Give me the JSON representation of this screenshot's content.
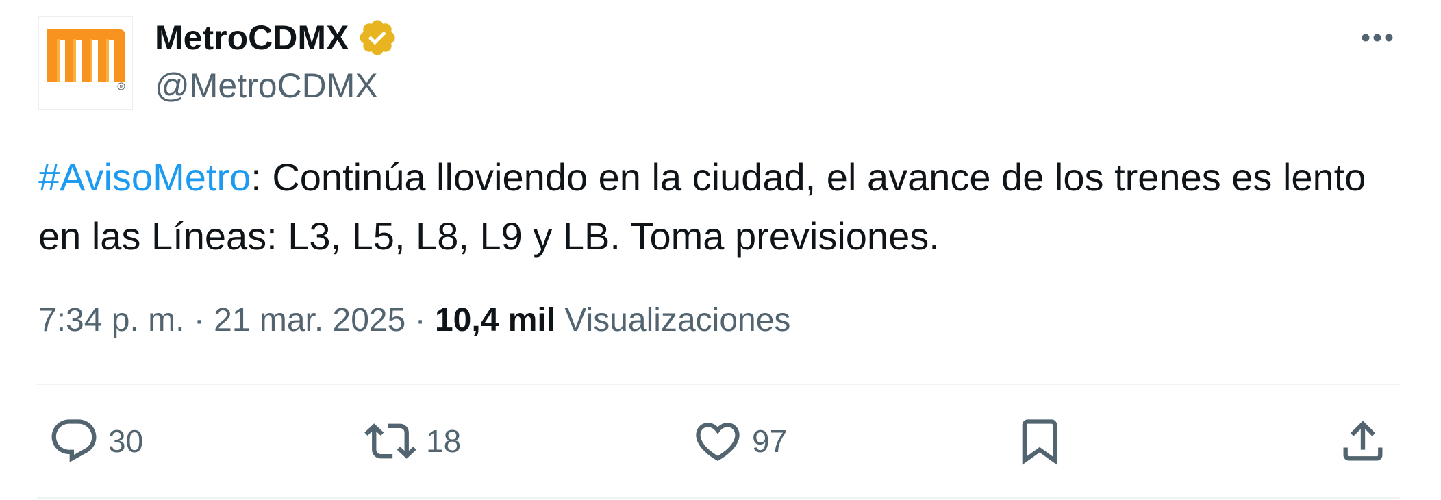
{
  "account": {
    "display_name": "MetroCDMX",
    "handle": "@MetroCDMX",
    "verified": true,
    "avatar_icon": "metro-cdmx-logo-icon",
    "brand_color": "#f7931e"
  },
  "tweet": {
    "hashtag": "#AvisoMetro",
    "text": ": Continúa lloviendo en la ciudad, el avance de los trenes es lento en las Líneas: L3, L5, L8, L9 y LB. Toma previsiones.",
    "hashtag_color": "#1d9bf0"
  },
  "meta": {
    "time": "7:34 p. m.",
    "separator": " · ",
    "date": "21 mar. 2025",
    "views_count": "10,4 mil",
    "views_label": "Visualizaciones"
  },
  "actions": {
    "reply": {
      "icon": "reply-icon",
      "count": "30"
    },
    "retweet": {
      "icon": "retweet-icon",
      "count": "18"
    },
    "like": {
      "icon": "heart-icon",
      "count": "97"
    },
    "bookmark": {
      "icon": "bookmark-icon"
    },
    "share": {
      "icon": "share-icon"
    }
  },
  "colors": {
    "text_primary": "#0f1419",
    "text_secondary": "#536471",
    "verified_badge": "#e8b520"
  }
}
